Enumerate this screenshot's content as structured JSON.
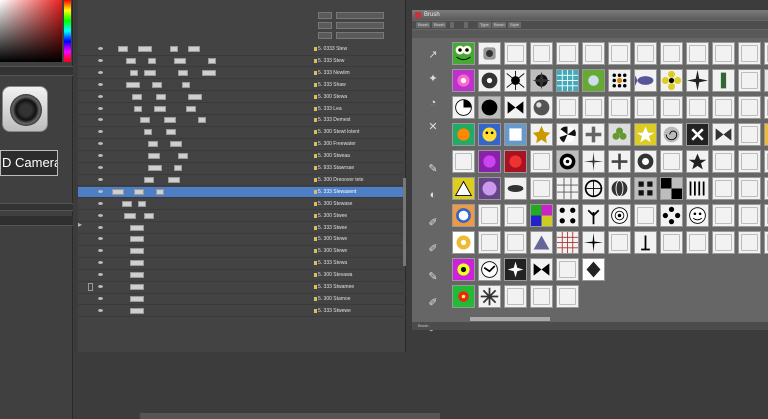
{
  "left_panel": {
    "camera_label": "D Camera",
    "colors": {
      "picker_hue": "#e8201e"
    }
  },
  "timeline": {
    "header_buttons": [
      "",
      "",
      ""
    ],
    "layers": [
      {
        "name": "5. 0333 Stew"
      },
      {
        "name": "5. 333 Stew"
      },
      {
        "name": "5. 333 Newiim"
      },
      {
        "name": "5. 333 Shaw"
      },
      {
        "name": "5. 300 Stewa"
      },
      {
        "name": "5. 333 Lea"
      },
      {
        "name": "5. 333 Demest"
      },
      {
        "name": "5. 300 Stewt lotent"
      },
      {
        "name": "5. 300 Freewater"
      },
      {
        "name": "5. 300 Stweaa"
      },
      {
        "name": "5. 933 Stawrsae"
      },
      {
        "name": "5. 300 Dreoover tete"
      },
      {
        "name": "5. 333 Slewasent",
        "selected": true
      },
      {
        "name": "5. 300 Stewase"
      },
      {
        "name": "5. 300 Stwee"
      },
      {
        "name": "5. 333 Stwee"
      },
      {
        "name": "5. 300 Stewe"
      },
      {
        "name": "5. 300 Stewe"
      },
      {
        "name": "5. 333 Stewa"
      },
      {
        "name": "5. 300 Stevawa"
      },
      {
        "name": "5. 333 Stwamee"
      },
      {
        "name": "5. 300 Stamoe"
      },
      {
        "name": "5. 333 Stwewe"
      }
    ],
    "selection_color": "#4d7fc7"
  },
  "brush_panel": {
    "title": "Brush",
    "tabs": [
      "Brush",
      "Brush",
      "",
      "",
      "Type",
      "Brush",
      "Style"
    ],
    "status": "Brush",
    "icons": [
      "frog-brush",
      "mug-brush",
      "blank",
      "blank",
      "blank",
      "blank",
      "blank",
      "blank",
      "blank",
      "blank",
      "blank",
      "blank",
      "blank",
      "flame-brush",
      "ornament-brush",
      "spider-brush",
      "splat-brush",
      "lattice-brush",
      "leaf-brush",
      "dots-brush",
      "fish-brush",
      "flower-brush",
      "sunburst-brush",
      "cactus-brush",
      "blank",
      "plus-brush",
      "pie-brush",
      "circle-brush",
      "bowtie-brush",
      "sphere-brush",
      "blank",
      "blank",
      "blank",
      "blank",
      "blank",
      "blank",
      "blank",
      "blank",
      "blank",
      "gradient-brush",
      "face-brush",
      "box-brush",
      "leaf-star-brush",
      "fan-brush",
      "plus-cross-brush",
      "flower2-brush",
      "star-brush",
      "spiral-brush",
      "cross-brush",
      "bowtie2-brush",
      "blank",
      "flower3-brush",
      "blank",
      "flower4-brush",
      "splat2-brush",
      "blank",
      "mandala-brush",
      "burst-brush",
      "cross2-brush",
      "dots2-brush",
      "blank",
      "star2-brush",
      "blank",
      "blank",
      "blank",
      "triangle-brush",
      "sphere2-brush",
      "fish2-brush",
      "blank",
      "pattern-brush",
      "wheel-brush",
      "globe-brush",
      "pixel-brush",
      "checker-brush",
      "bars-brush",
      "blank",
      "blank",
      "blank",
      "ring-brush",
      "blank",
      "blank",
      "quilt-brush",
      "dots3-brush",
      "plant-brush",
      "spiral2-brush",
      "blank",
      "daisy-brush",
      "smile-brush",
      "blank",
      "blank",
      "blank",
      "ornament2-brush",
      "blank",
      "blank",
      "triangle2-brush",
      "grid-brush",
      "burst2-brush",
      "blank",
      "vase-brush",
      "blank",
      "blank",
      "blank",
      "blank",
      "blank",
      "flower5-brush",
      "bird-brush",
      "cross3-brush",
      "bowtie3-brush",
      "blank",
      "thorn-brush",
      "blank",
      "blank",
      "blank",
      "blank",
      "blank",
      "blank",
      "blank",
      "swirl-brush",
      "flake-brush",
      "blank",
      "blank",
      "blank",
      "blank",
      "blank",
      "blank",
      "blank",
      "blank",
      "blank",
      "blank",
      "blank"
    ]
  }
}
